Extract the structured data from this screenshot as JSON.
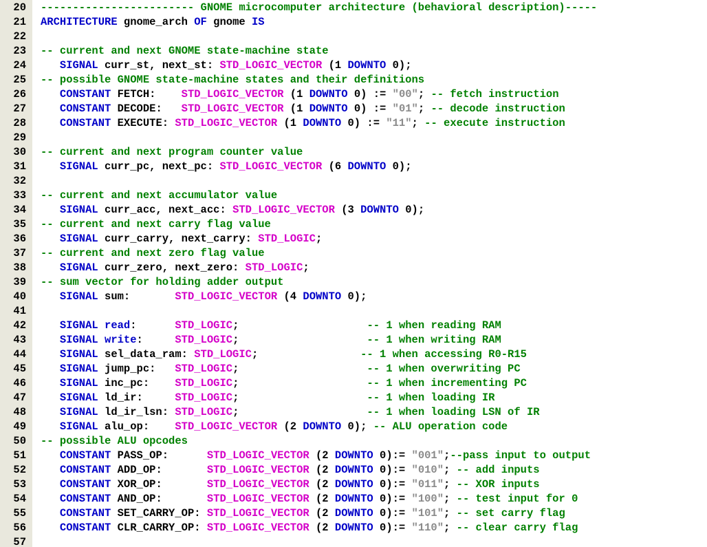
{
  "editor": {
    "colors": {
      "gutter": "#e9e8dd",
      "keyword": "#0000c8",
      "type": "#d400c8",
      "string": "#8a8a8a",
      "comment": "#008000",
      "plain": "#000000"
    },
    "lines": [
      {
        "n": "20",
        "tokens": [
          [
            "c",
            "------------------------ GNOME microcomputer architecture (behavioral description)-----"
          ]
        ]
      },
      {
        "n": "21",
        "tokens": [
          [
            "k",
            "ARCHITECTURE"
          ],
          [
            "p",
            " gnome_arch "
          ],
          [
            "k",
            "OF"
          ],
          [
            "p",
            " gnome "
          ],
          [
            "k",
            "IS"
          ]
        ]
      },
      {
        "n": "22",
        "tokens": []
      },
      {
        "n": "23",
        "tokens": [
          [
            "c",
            "-- current and next GNOME state-machine state"
          ]
        ]
      },
      {
        "n": "24",
        "tokens": [
          [
            "p",
            "   "
          ],
          [
            "k",
            "SIGNAL"
          ],
          [
            "p",
            " curr_st, next_st: "
          ],
          [
            "t",
            "STD_LOGIC_VECTOR"
          ],
          [
            "p",
            " (1 "
          ],
          [
            "k",
            "DOWNTO"
          ],
          [
            "p",
            " 0);"
          ]
        ]
      },
      {
        "n": "25",
        "tokens": [
          [
            "c",
            "-- possible GNOME state-machine states and their definitions"
          ]
        ]
      },
      {
        "n": "26",
        "tokens": [
          [
            "p",
            "   "
          ],
          [
            "k",
            "CONSTANT"
          ],
          [
            "p",
            " FETCH:    "
          ],
          [
            "t",
            "STD_LOGIC_VECTOR"
          ],
          [
            "p",
            " (1 "
          ],
          [
            "k",
            "DOWNTO"
          ],
          [
            "p",
            " 0) := "
          ],
          [
            "s",
            "\"00\""
          ],
          [
            "p",
            "; "
          ],
          [
            "c",
            "-- fetch instruction"
          ]
        ]
      },
      {
        "n": "27",
        "tokens": [
          [
            "p",
            "   "
          ],
          [
            "k",
            "CONSTANT"
          ],
          [
            "p",
            " DECODE:   "
          ],
          [
            "t",
            "STD_LOGIC_VECTOR"
          ],
          [
            "p",
            " (1 "
          ],
          [
            "k",
            "DOWNTO"
          ],
          [
            "p",
            " 0) := "
          ],
          [
            "s",
            "\"01\""
          ],
          [
            "p",
            "; "
          ],
          [
            "c",
            "-- decode instruction"
          ]
        ]
      },
      {
        "n": "28",
        "tokens": [
          [
            "p",
            "   "
          ],
          [
            "k",
            "CONSTANT"
          ],
          [
            "p",
            " EXECUTE: "
          ],
          [
            "t",
            "STD_LOGIC_VECTOR"
          ],
          [
            "p",
            " (1 "
          ],
          [
            "k",
            "DOWNTO"
          ],
          [
            "p",
            " 0) := "
          ],
          [
            "s",
            "\"11\""
          ],
          [
            "p",
            "; "
          ],
          [
            "c",
            "-- execute instruction"
          ]
        ]
      },
      {
        "n": "29",
        "tokens": []
      },
      {
        "n": "30",
        "tokens": [
          [
            "c",
            "-- current and next program counter value"
          ]
        ]
      },
      {
        "n": "31",
        "tokens": [
          [
            "p",
            "   "
          ],
          [
            "k",
            "SIGNAL"
          ],
          [
            "p",
            " curr_pc, next_pc: "
          ],
          [
            "t",
            "STD_LOGIC_VECTOR"
          ],
          [
            "p",
            " (6 "
          ],
          [
            "k",
            "DOWNTO"
          ],
          [
            "p",
            " 0);"
          ]
        ]
      },
      {
        "n": "32",
        "tokens": []
      },
      {
        "n": "33",
        "tokens": [
          [
            "c",
            "-- current and next accumulator value"
          ]
        ]
      },
      {
        "n": "34",
        "tokens": [
          [
            "p",
            "   "
          ],
          [
            "k",
            "SIGNAL"
          ],
          [
            "p",
            " curr_acc, next_acc: "
          ],
          [
            "t",
            "STD_LOGIC_VECTOR"
          ],
          [
            "p",
            " (3 "
          ],
          [
            "k",
            "DOWNTO"
          ],
          [
            "p",
            " 0);"
          ]
        ]
      },
      {
        "n": "35",
        "tokens": [
          [
            "c",
            "-- current and next carry flag value"
          ]
        ]
      },
      {
        "n": "36",
        "tokens": [
          [
            "p",
            "   "
          ],
          [
            "k",
            "SIGNAL"
          ],
          [
            "p",
            " curr_carry, next_carry: "
          ],
          [
            "t",
            "STD_LOGIC"
          ],
          [
            "p",
            ";"
          ]
        ]
      },
      {
        "n": "37",
        "tokens": [
          [
            "c",
            "-- current and next zero flag value"
          ]
        ]
      },
      {
        "n": "38",
        "tokens": [
          [
            "p",
            "   "
          ],
          [
            "k",
            "SIGNAL"
          ],
          [
            "p",
            " curr_zero, next_zero: "
          ],
          [
            "t",
            "STD_LOGIC"
          ],
          [
            "p",
            ";"
          ]
        ]
      },
      {
        "n": "39",
        "tokens": [
          [
            "c",
            "-- sum vector for holding adder output"
          ]
        ]
      },
      {
        "n": "40",
        "tokens": [
          [
            "p",
            "   "
          ],
          [
            "k",
            "SIGNAL"
          ],
          [
            "p",
            " sum:       "
          ],
          [
            "t",
            "STD_LOGIC_VECTOR"
          ],
          [
            "p",
            " (4 "
          ],
          [
            "k",
            "DOWNTO"
          ],
          [
            "p",
            " 0);"
          ]
        ]
      },
      {
        "n": "41",
        "tokens": []
      },
      {
        "n": "42",
        "tokens": [
          [
            "p",
            "   "
          ],
          [
            "k",
            "SIGNAL"
          ],
          [
            "p",
            " "
          ],
          [
            "k",
            "read"
          ],
          [
            "p",
            ":      "
          ],
          [
            "t",
            "STD_LOGIC"
          ],
          [
            "p",
            ";                    "
          ],
          [
            "c",
            "-- 1 when reading RAM"
          ]
        ]
      },
      {
        "n": "43",
        "tokens": [
          [
            "p",
            "   "
          ],
          [
            "k",
            "SIGNAL"
          ],
          [
            "p",
            " "
          ],
          [
            "k",
            "write"
          ],
          [
            "p",
            ":     "
          ],
          [
            "t",
            "STD_LOGIC"
          ],
          [
            "p",
            ";                    "
          ],
          [
            "c",
            "-- 1 when writing RAM"
          ]
        ]
      },
      {
        "n": "44",
        "tokens": [
          [
            "p",
            "   "
          ],
          [
            "k",
            "SIGNAL"
          ],
          [
            "p",
            " sel_data_ram: "
          ],
          [
            "t",
            "STD_LOGIC"
          ],
          [
            "p",
            ";                "
          ],
          [
            "c",
            "-- 1 when accessing R0-R15"
          ]
        ]
      },
      {
        "n": "45",
        "tokens": [
          [
            "p",
            "   "
          ],
          [
            "k",
            "SIGNAL"
          ],
          [
            "p",
            " jump_pc:   "
          ],
          [
            "t",
            "STD_LOGIC"
          ],
          [
            "p",
            ";                    "
          ],
          [
            "c",
            "-- 1 when overwriting PC"
          ]
        ]
      },
      {
        "n": "46",
        "tokens": [
          [
            "p",
            "   "
          ],
          [
            "k",
            "SIGNAL"
          ],
          [
            "p",
            " inc_pc:    "
          ],
          [
            "t",
            "STD_LOGIC"
          ],
          [
            "p",
            ";                    "
          ],
          [
            "c",
            "-- 1 when incrementing PC"
          ]
        ]
      },
      {
        "n": "47",
        "tokens": [
          [
            "p",
            "   "
          ],
          [
            "k",
            "SIGNAL"
          ],
          [
            "p",
            " ld_ir:     "
          ],
          [
            "t",
            "STD_LOGIC"
          ],
          [
            "p",
            ";                    "
          ],
          [
            "c",
            "-- 1 when loading IR"
          ]
        ]
      },
      {
        "n": "48",
        "tokens": [
          [
            "p",
            "   "
          ],
          [
            "k",
            "SIGNAL"
          ],
          [
            "p",
            " ld_ir_lsn: "
          ],
          [
            "t",
            "STD_LOGIC"
          ],
          [
            "p",
            ";                    "
          ],
          [
            "c",
            "-- 1 when loading LSN of IR"
          ]
        ]
      },
      {
        "n": "49",
        "tokens": [
          [
            "p",
            "   "
          ],
          [
            "k",
            "SIGNAL"
          ],
          [
            "p",
            " alu_op:    "
          ],
          [
            "t",
            "STD_LOGIC_VECTOR"
          ],
          [
            "p",
            " (2 "
          ],
          [
            "k",
            "DOWNTO"
          ],
          [
            "p",
            " 0); "
          ],
          [
            "c",
            "-- ALU operation code"
          ]
        ]
      },
      {
        "n": "50",
        "tokens": [
          [
            "c",
            "-- possible ALU opcodes"
          ]
        ]
      },
      {
        "n": "51",
        "tokens": [
          [
            "p",
            "   "
          ],
          [
            "k",
            "CONSTANT"
          ],
          [
            "p",
            " PASS_OP:      "
          ],
          [
            "t",
            "STD_LOGIC_VECTOR"
          ],
          [
            "p",
            " (2 "
          ],
          [
            "k",
            "DOWNTO"
          ],
          [
            "p",
            " 0):= "
          ],
          [
            "s",
            "\"001\""
          ],
          [
            "p",
            ";"
          ],
          [
            "c",
            "--pass input to output"
          ]
        ]
      },
      {
        "n": "52",
        "tokens": [
          [
            "p",
            "   "
          ],
          [
            "k",
            "CONSTANT"
          ],
          [
            "p",
            " ADD_OP:       "
          ],
          [
            "t",
            "STD_LOGIC_VECTOR"
          ],
          [
            "p",
            " (2 "
          ],
          [
            "k",
            "DOWNTO"
          ],
          [
            "p",
            " 0):= "
          ],
          [
            "s",
            "\"010\""
          ],
          [
            "p",
            "; "
          ],
          [
            "c",
            "-- add inputs"
          ]
        ]
      },
      {
        "n": "53",
        "tokens": [
          [
            "p",
            "   "
          ],
          [
            "k",
            "CONSTANT"
          ],
          [
            "p",
            " XOR_OP:       "
          ],
          [
            "t",
            "STD_LOGIC_VECTOR"
          ],
          [
            "p",
            " (2 "
          ],
          [
            "k",
            "DOWNTO"
          ],
          [
            "p",
            " 0):= "
          ],
          [
            "s",
            "\"011\""
          ],
          [
            "p",
            "; "
          ],
          [
            "c",
            "-- XOR inputs"
          ]
        ]
      },
      {
        "n": "54",
        "tokens": [
          [
            "p",
            "   "
          ],
          [
            "k",
            "CONSTANT"
          ],
          [
            "p",
            " AND_OP:       "
          ],
          [
            "t",
            "STD_LOGIC_VECTOR"
          ],
          [
            "p",
            " (2 "
          ],
          [
            "k",
            "DOWNTO"
          ],
          [
            "p",
            " 0):= "
          ],
          [
            "s",
            "\"100\""
          ],
          [
            "p",
            "; "
          ],
          [
            "c",
            "-- test input for 0"
          ]
        ]
      },
      {
        "n": "55",
        "tokens": [
          [
            "p",
            "   "
          ],
          [
            "k",
            "CONSTANT"
          ],
          [
            "p",
            " SET_CARRY_OP: "
          ],
          [
            "t",
            "STD_LOGIC_VECTOR"
          ],
          [
            "p",
            " (2 "
          ],
          [
            "k",
            "DOWNTO"
          ],
          [
            "p",
            " 0):= "
          ],
          [
            "s",
            "\"101\""
          ],
          [
            "p",
            "; "
          ],
          [
            "c",
            "-- set carry flag"
          ]
        ]
      },
      {
        "n": "56",
        "tokens": [
          [
            "p",
            "   "
          ],
          [
            "k",
            "CONSTANT"
          ],
          [
            "p",
            " CLR_CARRY_OP: "
          ],
          [
            "t",
            "STD_LOGIC_VECTOR"
          ],
          [
            "p",
            " (2 "
          ],
          [
            "k",
            "DOWNTO"
          ],
          [
            "p",
            " 0):= "
          ],
          [
            "s",
            "\"110\""
          ],
          [
            "p",
            "; "
          ],
          [
            "c",
            "-- clear carry flag"
          ]
        ]
      },
      {
        "n": "57",
        "tokens": []
      }
    ]
  }
}
